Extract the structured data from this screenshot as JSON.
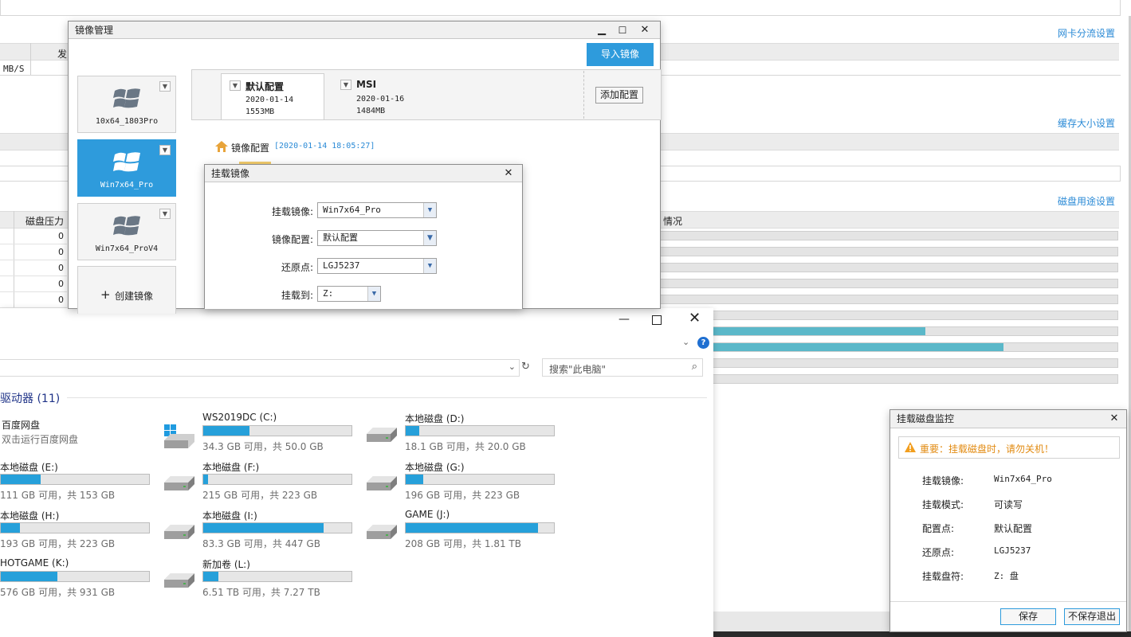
{
  "background": {
    "links": {
      "nic": "网卡分流设置",
      "cache": "缓存大小设置",
      "disk_usage": "磁盘用途设置"
    },
    "header_fa": "发",
    "speed_unit": "MB/S",
    "disk_pressure_header": "磁盘压力",
    "status_header": "情况",
    "pressure_values": [
      "0",
      "0",
      "0",
      "0",
      "0"
    ],
    "usage_bars": [
      0,
      0,
      0,
      0,
      0,
      0,
      0.58,
      0.75,
      0,
      0
    ]
  },
  "image_manager": {
    "title": "镜像管理",
    "import_button": "导入镜像",
    "images": [
      {
        "name": "10x64_1803Pro",
        "selected": false
      },
      {
        "name": "Win7x64_Pro",
        "selected": true
      },
      {
        "name": "Win7x64_ProV4",
        "selected": false
      }
    ],
    "create_label": "创建镜像",
    "configs": [
      {
        "name": "默认配置",
        "date": "2020-01-14",
        "size": "1553MB",
        "active": true
      },
      {
        "name": "MSI",
        "date": "2020-01-16",
        "size": "1484MB",
        "active": false
      }
    ],
    "add_config_button": "添加配置",
    "tree_root": "镜像配置",
    "tree_timestamp": "[2020-01-14 18:05:27]"
  },
  "mount_dialog": {
    "title": "挂载镜像",
    "fields": {
      "image_label": "挂载镜像:",
      "image_value": "Win7x64_Pro",
      "config_label": "镜像配置:",
      "config_value": "默认配置",
      "restore_label": "还原点:",
      "restore_value": "LGJ5237",
      "target_label": "挂载到:",
      "target_value": "Z:"
    }
  },
  "explorer": {
    "search_placeholder": "搜索\"此电脑\"",
    "section_title": "驱动器 (11)",
    "baidu": {
      "name": "百度网盘",
      "sub": "双击运行百度网盘"
    },
    "drives": [
      {
        "name": "WS2019DC (C:)",
        "info": "34.3 GB 可用，共 50.0 GB",
        "used": 0.31,
        "icon": "windows-drive"
      },
      {
        "name": "本地磁盘 (D:)",
        "info": "18.1 GB 可用，共 20.0 GB",
        "used": 0.09,
        "icon": "hdd"
      },
      {
        "name": "本地磁盘 (E:)",
        "info": "111 GB 可用，共 153 GB",
        "used": 0.27,
        "icon": "hdd"
      },
      {
        "name": "本地磁盘 (F:)",
        "info": "215 GB 可用，共 223 GB",
        "used": 0.03,
        "icon": "hdd"
      },
      {
        "name": "本地磁盘 (G:)",
        "info": "196 GB 可用，共 223 GB",
        "used": 0.12,
        "icon": "hdd"
      },
      {
        "name": "本地磁盘 (H:)",
        "info": "193 GB 可用，共 223 GB",
        "used": 0.13,
        "icon": "hdd"
      },
      {
        "name": "本地磁盘 (I:)",
        "info": "83.3 GB 可用，共 447 GB",
        "used": 0.81,
        "icon": "hdd"
      },
      {
        "name": "GAME (J:)",
        "info": "208 GB 可用，共 1.81 TB",
        "used": 0.89,
        "icon": "hdd"
      },
      {
        "name": "HOTGAME (K:)",
        "info": "576 GB 可用，共 931 GB",
        "used": 0.38,
        "icon": "hdd"
      },
      {
        "name": "新加卷 (L:)",
        "info": "6.51 TB 可用，共 7.27 TB",
        "used": 0.1,
        "icon": "hdd"
      }
    ]
  },
  "monitor": {
    "title": "挂载磁盘监控",
    "warning": "重要：挂载磁盘时，请勿关机！",
    "rows": [
      {
        "k": "挂载镜像:",
        "v": "Win7x64_Pro"
      },
      {
        "k": "挂载模式:",
        "v": "可读写"
      },
      {
        "k": "配置点:",
        "v": "默认配置"
      },
      {
        "k": "还原点:",
        "v": "LGJ5237"
      },
      {
        "k": "挂载盘符:",
        "v": "Z: 盘"
      }
    ],
    "save_button": "保存",
    "exit_button": "不保存退出"
  },
  "colors": {
    "accent": "#2e9bdc",
    "bar": "#5bb8c9",
    "drive_fill": "#26a0da",
    "warning": "#f29e1e"
  }
}
